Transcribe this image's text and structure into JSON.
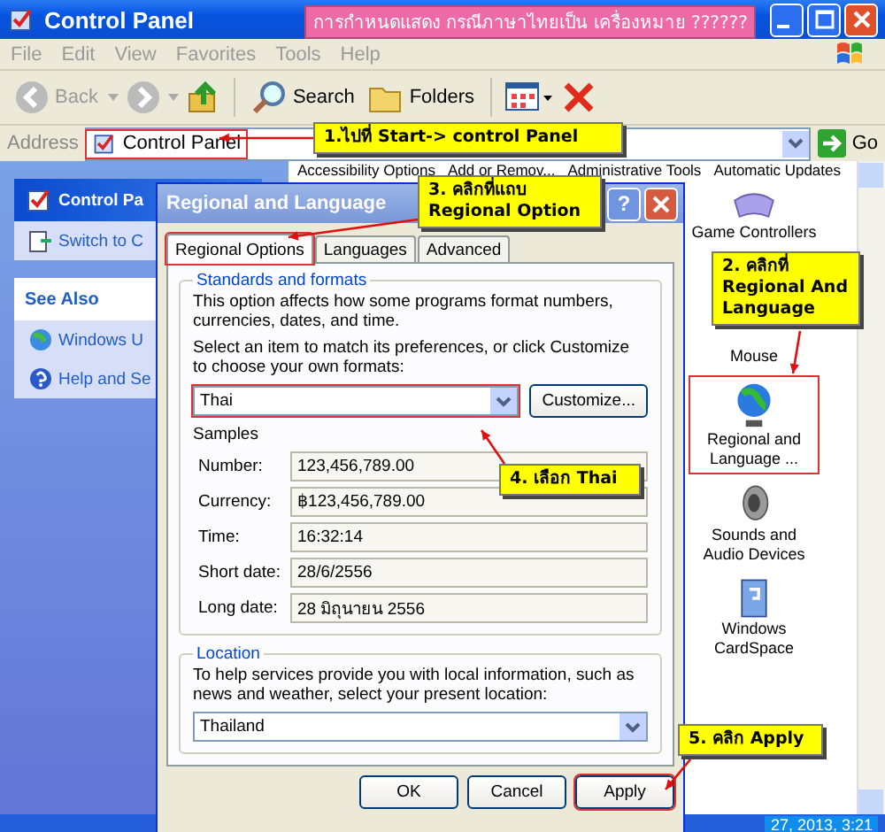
{
  "window": {
    "title": "Control Panel"
  },
  "banner": "การกำหนดแสดง กรณีภาษาไทยเป็น เครื่องหมาย ??????",
  "menu": [
    "File",
    "Edit",
    "View",
    "Favorites",
    "Tools",
    "Help"
  ],
  "toolbar": {
    "back": "Back",
    "search": "Search",
    "folders": "Folders"
  },
  "address": {
    "label": "Address",
    "value": "Control Panel",
    "go": "Go",
    "highlighted": true
  },
  "sidebar": {
    "panel_title": "Control Pa",
    "switch_link": "Switch to C",
    "see_also": {
      "title": "See Also",
      "links": [
        "Windows U",
        "Help and Se"
      ]
    }
  },
  "top_icons": [
    "Accessibility Options",
    "Add or Remov...",
    "Administrative Tools",
    "Automatic Updates"
  ],
  "icons": [
    {
      "kind": "gamepad",
      "label": "Game Controllers",
      "highlighted": false
    },
    {
      "kind": "none",
      "label": "Mouse",
      "highlighted": false
    },
    {
      "kind": "globe",
      "label": "Regional and Language ...",
      "highlighted": true
    },
    {
      "kind": "speaker",
      "label": "Sounds and Audio Devices",
      "highlighted": false
    },
    {
      "kind": "card",
      "label": "Windows CardSpace",
      "highlighted": false
    }
  ],
  "dialog": {
    "title": "Regional and Language",
    "help": "?",
    "tabs": [
      {
        "label": "Regional Options",
        "selected": true,
        "highlighted": true
      },
      {
        "label": "Languages",
        "selected": false,
        "highlighted": false
      },
      {
        "label": "Advanced",
        "selected": false,
        "highlighted": false
      }
    ],
    "standards": {
      "legend": "Standards and formats",
      "description": "This option affects how some programs format numbers, currencies, dates, and time.",
      "prompt": "Select an item to match its preferences, or click Customize to choose your own formats:",
      "format": "Thai",
      "format_highlighted": true,
      "customize": "Customize...",
      "samples_label": "Samples",
      "samples": [
        {
          "label": "Number:",
          "value": "123,456,789.00"
        },
        {
          "label": "Currency:",
          "value": "฿123,456,789.00"
        },
        {
          "label": "Time:",
          "value": "16:32:14"
        },
        {
          "label": "Short date:",
          "value": "28/6/2556"
        },
        {
          "label": "Long date:",
          "value": "28 มิถุนายน 2556"
        }
      ]
    },
    "location": {
      "legend": "Location",
      "description": "To help services provide you with local information, such as news and weather, select your present location:",
      "value": "Thailand"
    },
    "buttons": [
      {
        "label": "OK",
        "highlighted": false
      },
      {
        "label": "Cancel",
        "highlighted": false
      },
      {
        "label": "Apply",
        "highlighted": true
      }
    ]
  },
  "callouts": [
    "1.ไปที่ Start-> control Panel",
    "2. คลิกที่ Regional And Language",
    "3. คลิกที่แถบ Regional Option",
    "4. เลือก Thai",
    "5. คลิก Apply"
  ],
  "taskbar": {
    "clock": "27, 2013, 3:21"
  }
}
